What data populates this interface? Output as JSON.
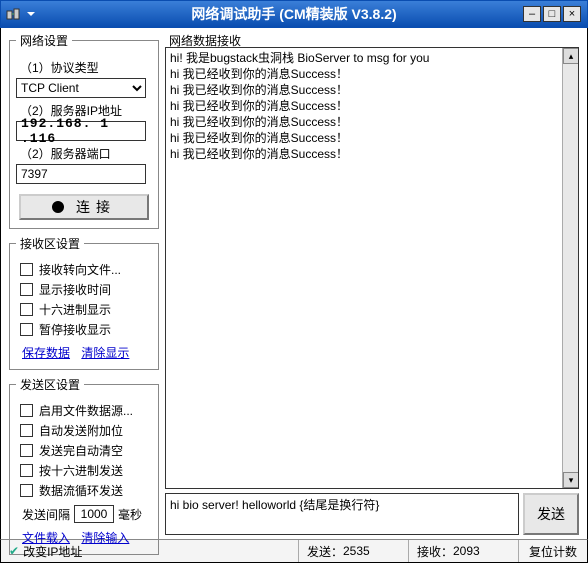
{
  "window": {
    "title": "网络调试助手 (CM精装版 V3.8.2)"
  },
  "left": {
    "net_settings": {
      "legend": "网络设置",
      "protocol_label": "（1）协议类型",
      "protocol_value": "TCP Client",
      "ip_label": "（2）服务器IP地址",
      "ip_value": "192.168. 1 .116",
      "port_label": "（2）服务器端口",
      "port_value": "7397",
      "connect_label": "连接"
    },
    "recv_settings": {
      "legend": "接收区设置",
      "opts": [
        "接收转向文件...",
        "显示接收时间",
        "十六进制显示",
        "暂停接收显示"
      ],
      "save_link": "保存数据",
      "clear_link": "清除显示"
    },
    "send_settings": {
      "legend": "发送区设置",
      "opts": [
        "启用文件数据源...",
        "自动发送附加位",
        "发送完自动清空",
        "按十六进制发送",
        "数据流循环发送"
      ],
      "interval_label": "发送间隔",
      "interval_value": "1000",
      "interval_unit": "毫秒",
      "file_link": "文件载入",
      "clear_link": "清除输入"
    }
  },
  "right": {
    "recv_label": "网络数据接收",
    "recv_lines": [
      "hi! 我是bugstack虫洞栈 BioServer to msg for you",
      "hi 我已经收到你的消息Success！",
      "hi 我已经收到你的消息Success！",
      "hi 我已经收到你的消息Success！",
      "hi 我已经收到你的消息Success！",
      "hi 我已经收到你的消息Success！",
      "hi 我已经收到你的消息Success！"
    ],
    "send_value": "hi bio server! helloworld {结尾是换行符}",
    "send_btn": "发送"
  },
  "status": {
    "ip_change": "改变IP地址",
    "send_label": "发送：",
    "send_count": "2535",
    "recv_label": "接收：",
    "recv_count": "2093",
    "reset": "复位计数"
  }
}
